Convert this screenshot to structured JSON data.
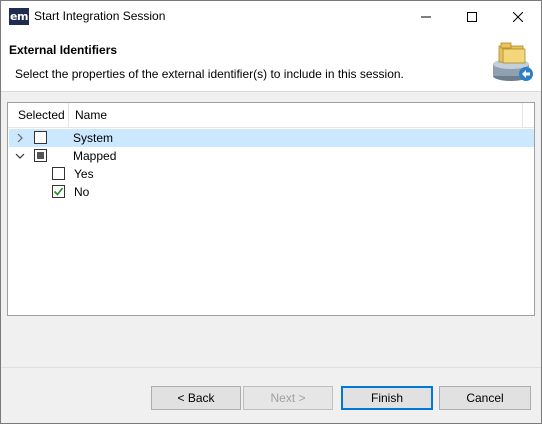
{
  "window": {
    "title": "Start Integration Session",
    "app_icon_text": "em"
  },
  "banner": {
    "title": "External Identifiers",
    "description": "Select the properties of the external identifier(s) to include in this session."
  },
  "table": {
    "headers": [
      "Selected",
      "Name"
    ],
    "rows": [
      {
        "label": "System",
        "level": 0,
        "expander": "collapsed",
        "check": "unchecked",
        "highlighted": true
      },
      {
        "label": "Mapped",
        "level": 0,
        "expander": "expanded",
        "check": "partial",
        "highlighted": false
      },
      {
        "label": "Yes",
        "level": 1,
        "expander": "none",
        "check": "unchecked",
        "highlighted": false
      },
      {
        "label": "No",
        "level": 1,
        "expander": "none",
        "check": "checked",
        "highlighted": false
      }
    ]
  },
  "buttons": {
    "back": "< Back",
    "next": "Next >",
    "finish": "Finish",
    "cancel": "Cancel"
  },
  "colors": {
    "selection": "#cce8ff",
    "check_green": "#2a8a2a",
    "default_border": "#0078d7"
  },
  "icons": {
    "banner": "database-folder-icon"
  }
}
